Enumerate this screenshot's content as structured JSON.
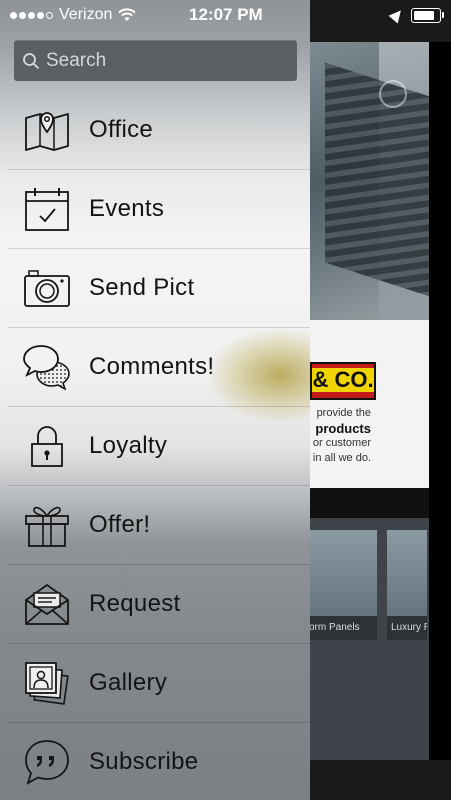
{
  "status_bar": {
    "carrier": "Verizon",
    "time": "12:07 PM",
    "signal_dots_filled": 4,
    "signal_dots_total": 5
  },
  "search": {
    "placeholder": "Search"
  },
  "menu": {
    "items": [
      {
        "label": "Office",
        "icon": "map-location-icon"
      },
      {
        "label": "Events",
        "icon": "calendar-icon"
      },
      {
        "label": "Send Pict",
        "icon": "camera-icon"
      },
      {
        "label": "Comments!",
        "icon": "speech-bubbles-icon"
      },
      {
        "label": "Loyalty",
        "icon": "lock-icon"
      },
      {
        "label": "Offer!",
        "icon": "gift-icon"
      },
      {
        "label": "Request",
        "icon": "envelope-icon"
      },
      {
        "label": "Gallery",
        "icon": "photo-gallery-icon"
      },
      {
        "label": "Subscribe",
        "icon": "quote-bubble-icon"
      }
    ]
  },
  "background": {
    "logo_text": "& CO.",
    "info_lines": [
      "provide the",
      "products",
      "or customer",
      "in all we do."
    ],
    "tile_caption_1": "orm Panels",
    "tile_caption_2": "Luxury Rol"
  }
}
